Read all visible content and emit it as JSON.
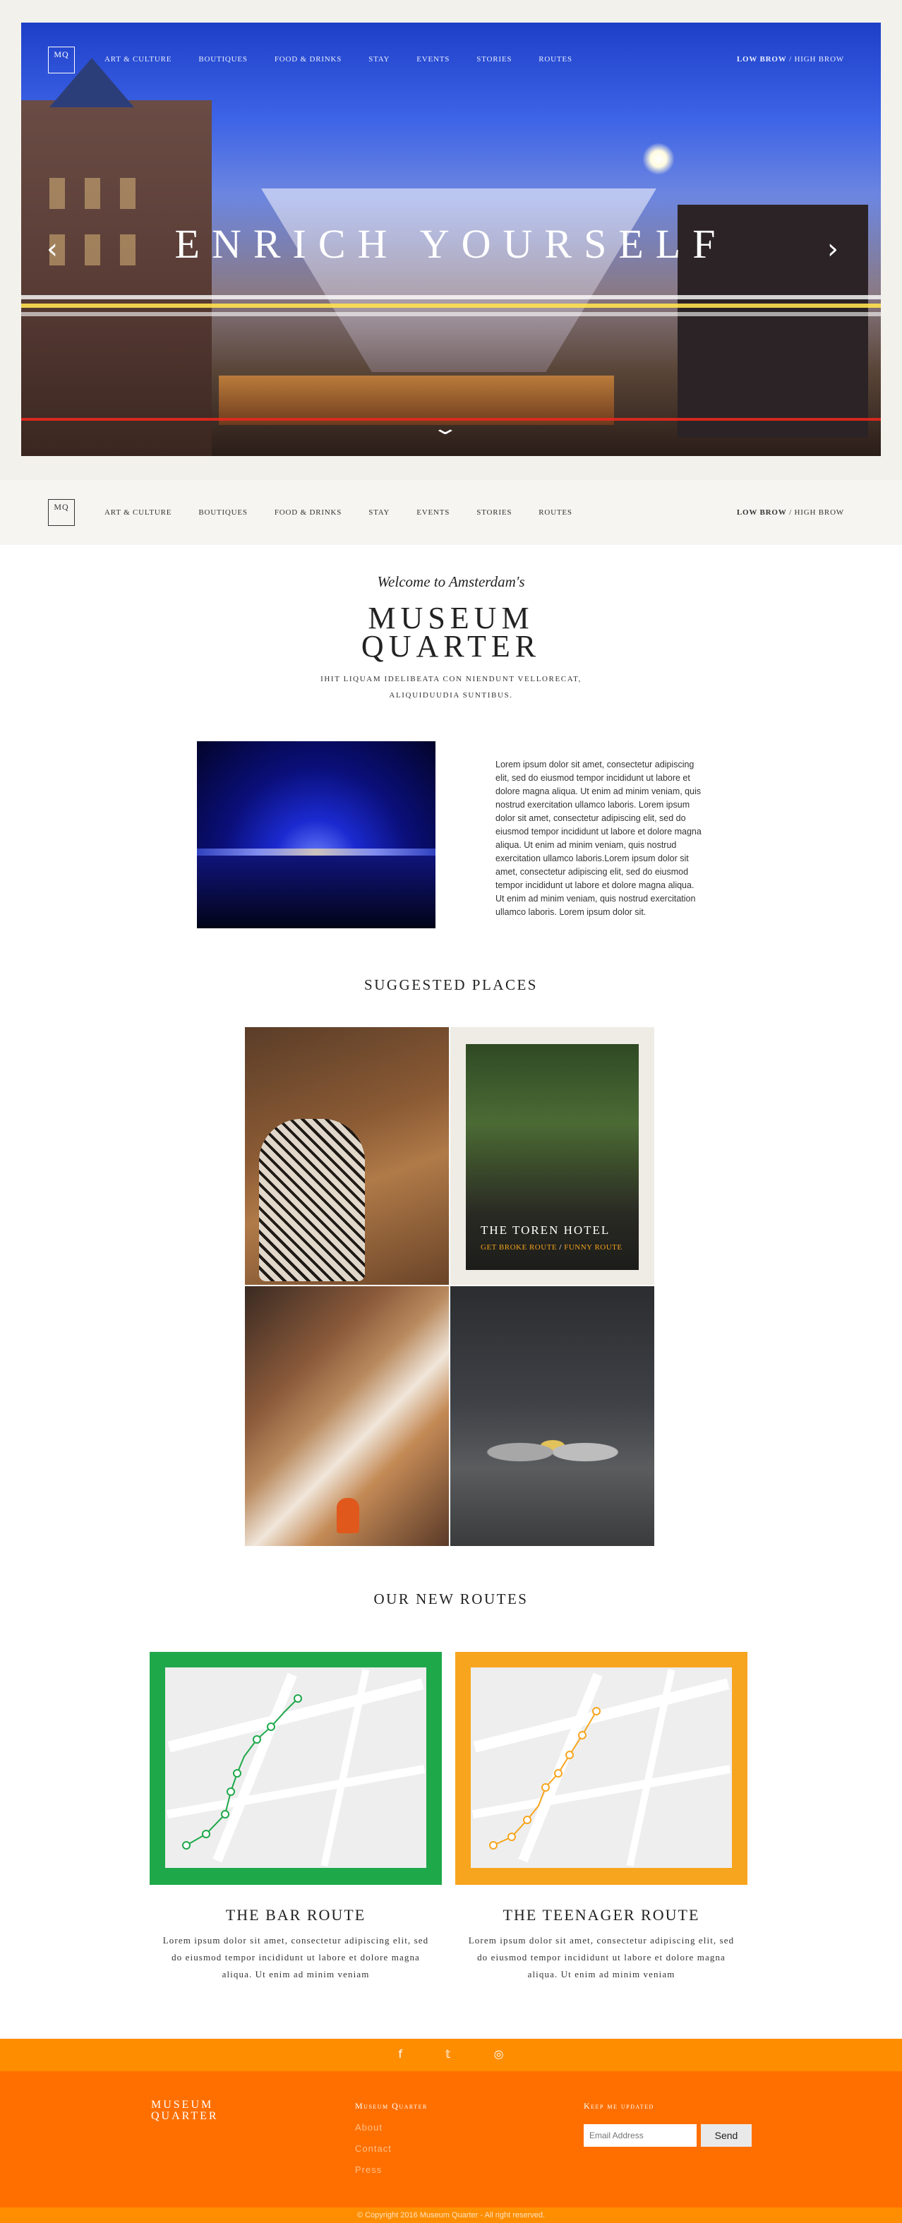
{
  "nav": {
    "logo": "MQ",
    "items": [
      "ART & CULTURE",
      "BOUTIQUES",
      "FOOD & DRINKS",
      "STAY",
      "EVENTS",
      "STORIES",
      "ROUTES"
    ],
    "brow_low": "LOW BROW",
    "brow_sep": " / ",
    "brow_high": "HIGH BROW"
  },
  "hero": {
    "title": "ENRICH YOURSELF",
    "prev_icon": "chevron-left-icon",
    "next_icon": "chevron-right-icon",
    "down_icon": "chevron-down-icon"
  },
  "intro": {
    "welcome": "Welcome to Amsterdam's",
    "title_line1": "MUSEUM",
    "title_line2": "QUARTER",
    "tagline": "Ihit liquam idelibeata con niendunt vellorecat, aliquiduudia suntibus.",
    "body": "Lorem ipsum dolor sit amet, consectetur adipiscing elit, sed do eiusmod tempor incididunt ut labore et dolore magna aliqua. Ut enim ad minim veniam, quis nostrud exercitation ullamco laboris. Lorem ipsum dolor sit amet, consectetur adipiscing elit, sed do eiusmod tempor incididunt ut labore et dolore magna aliqua. Ut enim ad minim veniam, quis nostrud exercitation ullamco laboris.Lorem ipsum dolor sit amet, consectetur adipiscing elit, sed do eiusmod tempor incididunt ut labore et dolore magna aliqua. Ut enim ad minim veniam, quis nostrud exercitation ullamco laboris. Lorem ipsum dolor sit."
  },
  "suggested": {
    "heading": "SUGGESTED PLACES",
    "featured_name": "THE TOREN HOTEL",
    "featured_link1": "GET BROKE ROUTE",
    "featured_sep": " / ",
    "featured_link2": "FUNNY ROUTE"
  },
  "routes": {
    "heading": "OUR NEW ROUTES",
    "items": [
      {
        "title": "THE BAR ROUTE",
        "desc": "Lorem ipsum dolor sit amet, consectetur adipiscing elit, sed do eiusmod tempor incididunt ut labore et dolore magna aliqua. Ut enim ad minim veniam",
        "color": "#1fa84a"
      },
      {
        "title": "THE TEENAGER ROUTE",
        "desc": "Lorem ipsum dolor sit amet, consectetur adipiscing elit, sed do eiusmod tempor incididunt ut labore et dolore magna aliqua. Ut enim ad minim veniam",
        "color": "#f7a51e"
      }
    ]
  },
  "footer": {
    "social_icons": [
      "facebook-icon",
      "twitter-icon",
      "instagram-icon"
    ],
    "social_glyphs": [
      "f",
      "𝕥",
      "◎"
    ],
    "logo_line1": "MUSEUM",
    "logo_line2": "QUARTER",
    "col_heading": "Museum Quarter",
    "links": [
      "About",
      "Contact",
      "Press"
    ],
    "newsletter_heading": "Keep me updated",
    "email_placeholder": "Email Address",
    "send_label": "Send",
    "copyright": "© Copyright 2016 Museum Quarter - All right reserved."
  },
  "colors": {
    "accent_orange": "#ff6f00",
    "accent_orange_light": "#ff8d00",
    "route_green": "#1fa84a",
    "route_orange": "#f7a51e",
    "link_yellow": "#f0a21b"
  }
}
